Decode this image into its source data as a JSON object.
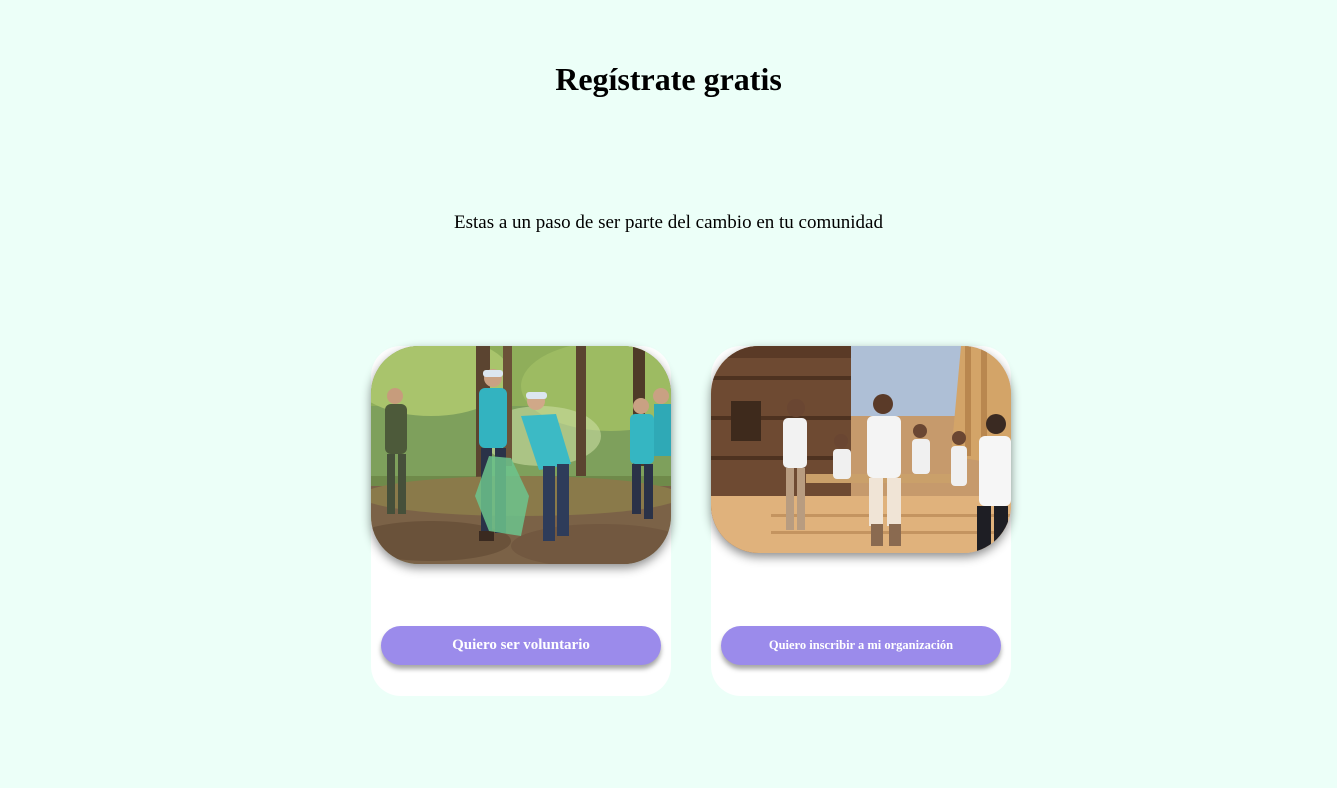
{
  "page": {
    "title": "Regístrate gratis",
    "subtitle": "Estas a un paso de ser parte del cambio en tu comunidad"
  },
  "cards": [
    {
      "image": "volunteers-cleaning-forest-photo",
      "button_label": "Quiero ser voluntario"
    },
    {
      "image": "volunteers-building-house-photo",
      "button_label": "Quiero inscribir a mi organización"
    }
  ],
  "colors": {
    "background": "#ecfff8",
    "card": "#ffffff",
    "button": "#9b8beb",
    "button_text": "#ffffff"
  }
}
